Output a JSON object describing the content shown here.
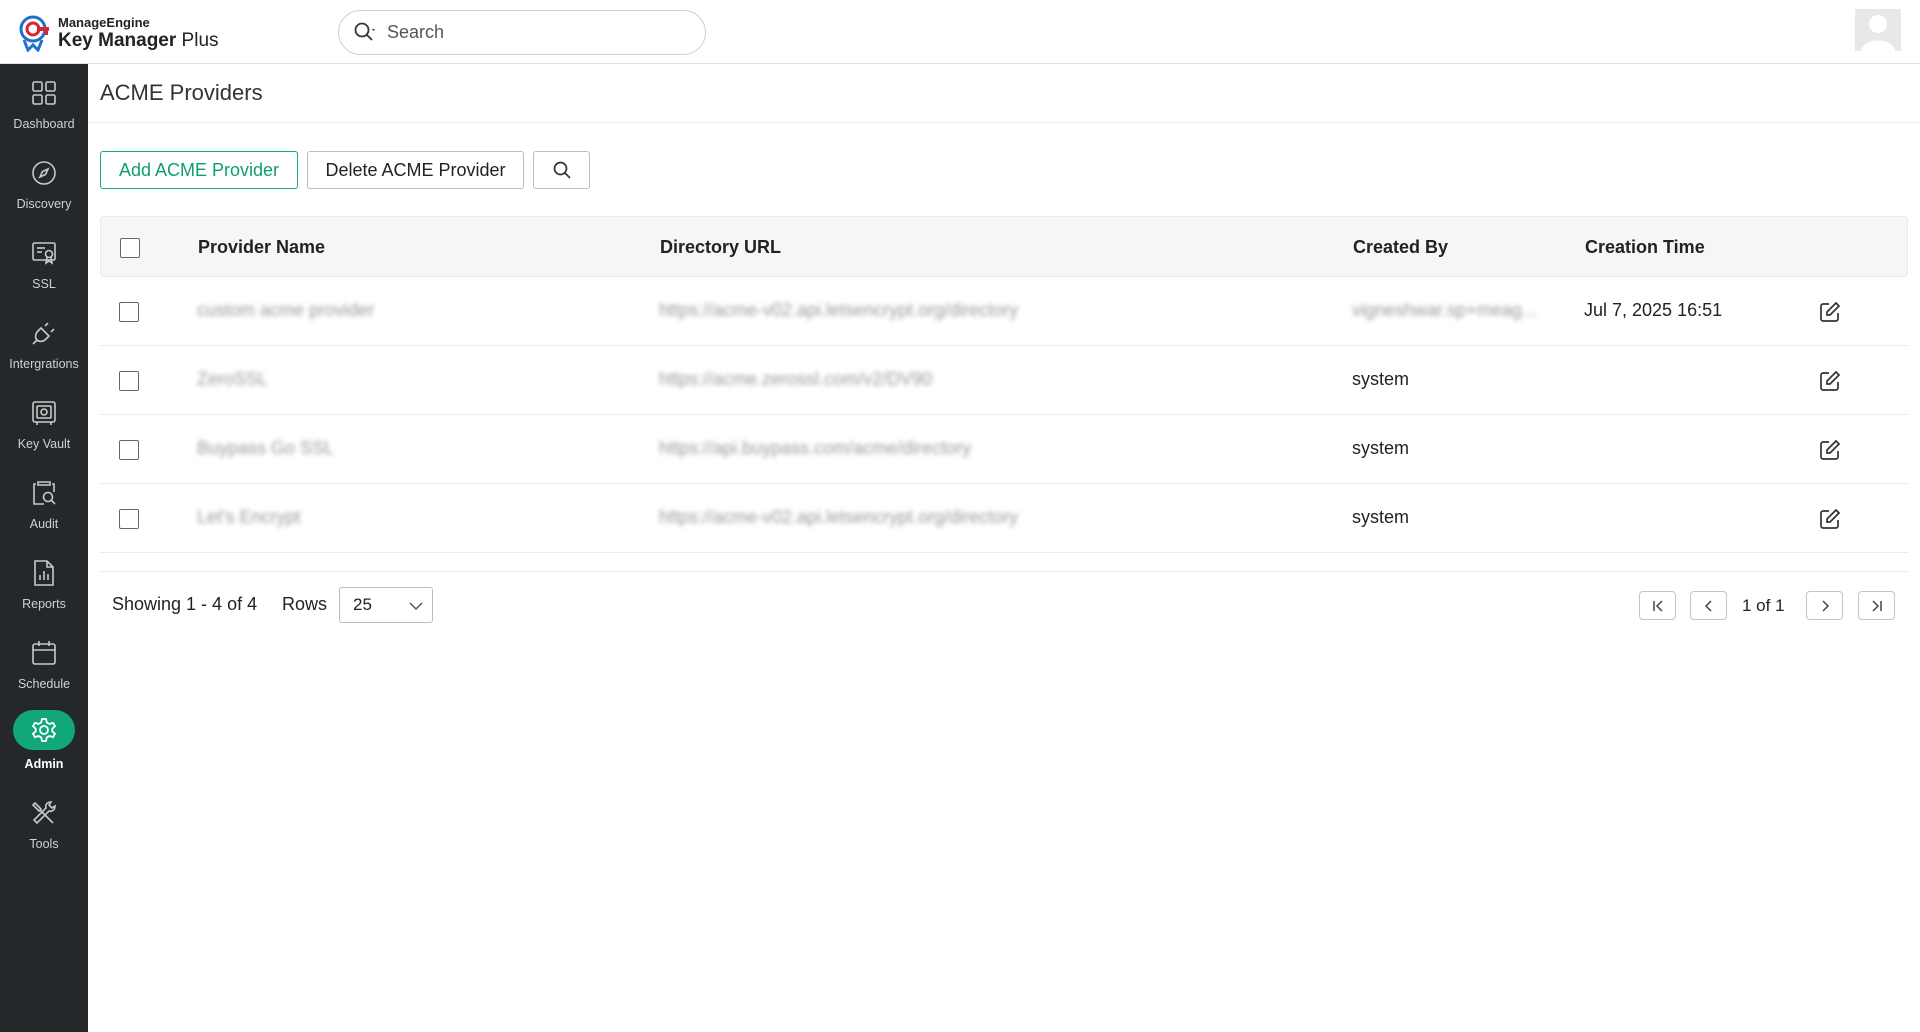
{
  "brand": {
    "company": "ManageEngine",
    "product_bold": "Key Manager",
    "product_rest": " Plus"
  },
  "search": {
    "placeholder": "Search"
  },
  "sidebar": {
    "items": [
      {
        "label": "Dashboard",
        "icon": "dashboard-icon"
      },
      {
        "label": "Discovery",
        "icon": "compass-icon"
      },
      {
        "label": "SSL",
        "icon": "certificate-icon"
      },
      {
        "label": "Intergrations",
        "icon": "plug-icon"
      },
      {
        "label": "Key Vault",
        "icon": "vault-icon"
      },
      {
        "label": "Audit",
        "icon": "audit-icon"
      },
      {
        "label": "Reports",
        "icon": "report-icon"
      },
      {
        "label": "Schedule",
        "icon": "calendar-icon"
      },
      {
        "label": "Admin",
        "icon": "gear-icon",
        "active": true
      },
      {
        "label": "Tools",
        "icon": "tools-icon"
      }
    ],
    "active_color": "#12a77a",
    "background": "#25282b"
  },
  "page": {
    "title": "ACME Providers"
  },
  "toolbar": {
    "add_label": "Add ACME Provider",
    "delete_label": "Delete ACME Provider"
  },
  "table": {
    "headers": {
      "name": "Provider Name",
      "url": "Directory URL",
      "created_by": "Created By",
      "creation_time": "Creation Time"
    },
    "rows": [
      {
        "name": "custom acme provider",
        "url": "https://acme-v02.api.letsencrypt.org/directory",
        "created_by": "vigneshwar.sp+meag...",
        "creation_time": "Jul 7, 2025 16:51"
      },
      {
        "name": "ZeroSSL",
        "url": "https://acme.zerossl.com/v2/DV90",
        "created_by": "system",
        "creation_time": ""
      },
      {
        "name": "Buypass Go SSL",
        "url": "https://api.buypass.com/acme/directory",
        "created_by": "system",
        "creation_time": ""
      },
      {
        "name": "Let's Encrypt",
        "url": "https://acme-v02.api.letsencrypt.org/directory",
        "created_by": "system",
        "creation_time": ""
      }
    ]
  },
  "footer": {
    "showing": "Showing 1 - 4 of 4",
    "rows_label": "Rows",
    "rows_value": "25",
    "page_info": "1 of 1"
  },
  "colors": {
    "accent": "#12a77a"
  }
}
